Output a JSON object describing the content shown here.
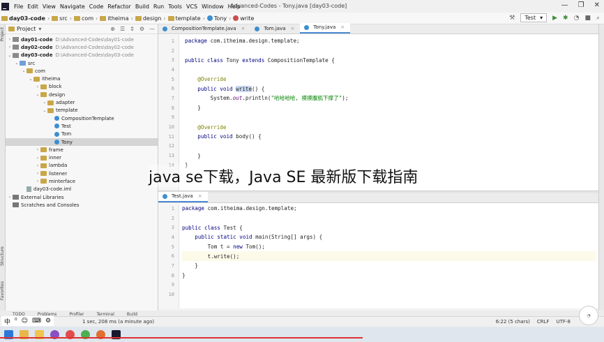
{
  "menubar": {
    "items": [
      "File",
      "Edit",
      "View",
      "Navigate",
      "Code",
      "Refactor",
      "Build",
      "Run",
      "Tools",
      "VCS",
      "Window",
      "Help"
    ],
    "window_title": "Advanced-Codes - Tony.java [day03-code]"
  },
  "breadcrumb": [
    "day03-code",
    "src",
    "com",
    "itheima",
    "design",
    "template",
    "Tony",
    "write"
  ],
  "run": {
    "config": "Test"
  },
  "project": {
    "title": "Project",
    "tree": [
      {
        "depth": 0,
        "arrow": "›",
        "icon": "module",
        "label": "day01-code",
        "path": "D:\\Advanced-Codes\\day01-code",
        "bold": true
      },
      {
        "depth": 0,
        "arrow": "›",
        "icon": "module",
        "label": "day02-code",
        "path": "D:\\Advanced-Codes\\day02-code",
        "bold": true
      },
      {
        "depth": 0,
        "arrow": "⌄",
        "icon": "module",
        "label": "day03-code",
        "path": "D:\\Advanced-Codes\\day03-code",
        "bold": true
      },
      {
        "depth": 1,
        "arrow": "⌄",
        "icon": "folder-blue",
        "label": "src"
      },
      {
        "depth": 2,
        "arrow": "⌄",
        "icon": "folder",
        "label": "com"
      },
      {
        "depth": 3,
        "arrow": "⌄",
        "icon": "folder",
        "label": "itheima"
      },
      {
        "depth": 4,
        "arrow": "›",
        "icon": "folder",
        "label": "block"
      },
      {
        "depth": 4,
        "arrow": "⌄",
        "icon": "folder",
        "label": "design"
      },
      {
        "depth": 5,
        "arrow": "›",
        "icon": "folder",
        "label": "adapter"
      },
      {
        "depth": 5,
        "arrow": "⌄",
        "icon": "folder",
        "label": "template"
      },
      {
        "depth": 6,
        "arrow": "",
        "icon": "class",
        "label": "CompositionTemplate"
      },
      {
        "depth": 6,
        "arrow": "",
        "icon": "class",
        "label": "Test"
      },
      {
        "depth": 6,
        "arrow": "",
        "icon": "class",
        "label": "Tom"
      },
      {
        "depth": 6,
        "arrow": "",
        "icon": "class",
        "label": "Tony",
        "selected": true
      },
      {
        "depth": 4,
        "arrow": "›",
        "icon": "folder",
        "label": "frame"
      },
      {
        "depth": 4,
        "arrow": "›",
        "icon": "folder",
        "label": "inner"
      },
      {
        "depth": 4,
        "arrow": "›",
        "icon": "folder",
        "label": "lambda"
      },
      {
        "depth": 4,
        "arrow": "›",
        "icon": "folder",
        "label": "listener"
      },
      {
        "depth": 4,
        "arrow": "›",
        "icon": "folder",
        "label": "minterface"
      },
      {
        "depth": 2,
        "arrow": "",
        "icon": "file",
        "label": "day03-code.iml"
      },
      {
        "depth": 0,
        "arrow": "›",
        "icon": "lib",
        "label": "External Libraries"
      },
      {
        "depth": 0,
        "arrow": "",
        "icon": "lib",
        "label": "Scratches and Consoles"
      }
    ]
  },
  "editor_top": {
    "tabs": [
      {
        "label": "CompositionTemplate.java",
        "active": false
      },
      {
        "label": "Tom.java",
        "active": false
      },
      {
        "label": "Tony.java",
        "active": true
      }
    ],
    "line_numbers": [
      "1",
      "2",
      "3",
      "4",
      "5",
      "6",
      "7",
      "8",
      "9",
      "10",
      "11",
      "12",
      "13",
      "14"
    ],
    "lines": [
      [
        {
          "t": "package ",
          "c": "kw"
        },
        {
          "t": "com.itheima.design.template;"
        }
      ],
      [],
      [
        {
          "t": "public class ",
          "c": "kw"
        },
        {
          "t": "Tony "
        },
        {
          "t": "extends ",
          "c": "kw"
        },
        {
          "t": "CompositionTemplate {"
        }
      ],
      [],
      [
        {
          "t": "    "
        },
        {
          "t": "@Override",
          "c": "ann"
        }
      ],
      [
        {
          "t": "    "
        },
        {
          "t": "public void ",
          "c": "kw"
        },
        {
          "t": "write",
          "c": "hl"
        },
        {
          "t": "() {"
        }
      ],
      [
        {
          "t": "        System."
        },
        {
          "t": "out",
          "c": "fld"
        },
        {
          "t": ".println("
        },
        {
          "t": "\"哈哈哈哈, 摸摸腹肌下撑了\"",
          "c": "str"
        },
        {
          "t": ");"
        }
      ],
      [
        {
          "t": "    }"
        }
      ],
      [],
      [
        {
          "t": "    "
        },
        {
          "t": "@Override",
          "c": "ann"
        }
      ],
      [
        {
          "t": "    "
        },
        {
          "t": "public void ",
          "c": "kw"
        },
        {
          "t": "body() {"
        }
      ],
      [],
      [
        {
          "t": "    }"
        }
      ],
      [
        {
          "t": "}"
        }
      ]
    ]
  },
  "editor_bottom": {
    "tabs": [
      {
        "label": "Test.java",
        "active": true
      }
    ],
    "line_numbers": [
      "1",
      "2",
      "3",
      "4",
      "5",
      "6",
      "7",
      "8",
      "9",
      "10"
    ],
    "lines": [
      [
        {
          "t": "package ",
          "c": "kw"
        },
        {
          "t": "com.itheima.design.template;"
        }
      ],
      [],
      [
        {
          "t": "public class ",
          "c": "kw"
        },
        {
          "t": "Test {"
        }
      ],
      [
        {
          "t": "    "
        },
        {
          "t": "public static void ",
          "c": "kw"
        },
        {
          "t": "main(String[] args) {"
        }
      ],
      [
        {
          "t": "        Tom t = "
        },
        {
          "t": "new ",
          "c": "kw"
        },
        {
          "t": "Tom();"
        }
      ],
      [
        {
          "t": "        t.write();"
        }
      ],
      [
        {
          "t": "    }"
        }
      ],
      [
        {
          "t": "}"
        }
      ],
      [],
      []
    ]
  },
  "tool_windows": [
    "TODO",
    "Problems",
    "Profiler",
    "Terminal",
    "Build"
  ],
  "status": {
    "message": "1 sec, 208 ms (a minute ago)",
    "position": "6:22 (5 chars)",
    "line_sep": "CRLF",
    "encoding": "UTF-8"
  },
  "left_tabs": [
    "Project",
    "Structure",
    "Favorites"
  ],
  "ime": {
    "items": [
      "中",
      "⁰",
      "☺",
      "⌨",
      "⚙"
    ]
  },
  "watermark": "java se下载，Java SE 最新版下载指南",
  "colors": {
    "accent": "#4a8bd4",
    "keyword": "#000080",
    "annotation": "#808000",
    "string": "#008000"
  }
}
